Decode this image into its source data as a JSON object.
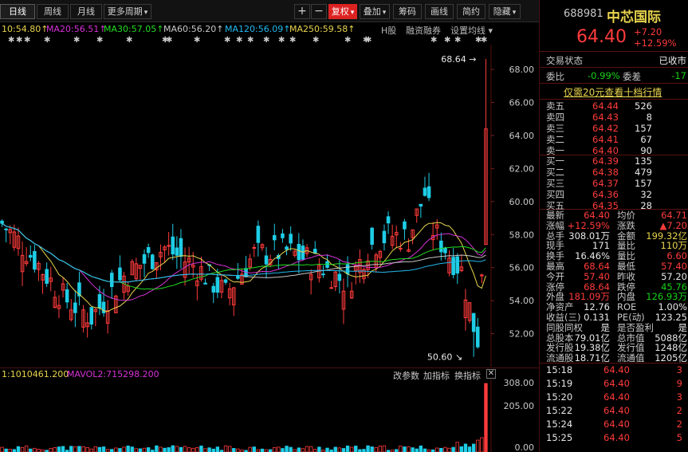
{
  "toolbar": {
    "tabs": [
      "日线",
      "周线",
      "月线",
      "更多周期"
    ],
    "buttons": [
      "+",
      "−",
      "复权",
      "叠加",
      "筹码",
      "画线",
      "简约",
      "隐藏"
    ]
  },
  "ma_line": [
    {
      "text": "10:54.80",
      "color": "#e8d44d"
    },
    {
      "text": "MA20:56.51",
      "color": "#d633d6"
    },
    {
      "text": "MA30:57.05",
      "color": "#22dd22"
    },
    {
      "text": "MA60:56.20",
      "color": "#c8c8c8"
    },
    {
      "text": "MA120:56.09",
      "color": "#22bbee"
    },
    {
      "text": "MA250:59.58",
      "color": "#e8d44d"
    }
  ],
  "ma_tools": [
    "H股",
    "融资融券",
    "设置均线"
  ],
  "price_axis": [
    "68.00",
    "66.00",
    "64.00",
    "62.00",
    "60.00",
    "58.00",
    "56.00",
    "54.00",
    "52.00"
  ],
  "annotations": {
    "high": "68.64",
    "low": "50.60"
  },
  "volume": {
    "mavol1": "1:1010461.200",
    "mavol2": "MAVOL2:715298.200",
    "tools": [
      "改参数",
      "加指标",
      "换指标"
    ],
    "axis": [
      "308.00",
      "205.00",
      "0.00"
    ]
  },
  "chart_data": {
    "type": "candlestick",
    "title": "",
    "ylim": [
      50.0,
      69.5
    ],
    "yticks": [
      52,
      54,
      56,
      58,
      60,
      62,
      64,
      66,
      68
    ],
    "high_marker": 68.64,
    "low_marker": 50.6,
    "last": 64.4
  },
  "quote": {
    "code": "688981",
    "name": "中芯国际",
    "price": "64.40",
    "change": "+7.20",
    "change_pct": "+12.59%",
    "status_label": "交易状态",
    "status_value": "已收市",
    "weibi_label": "委比",
    "weibi_value": "-0.99%",
    "weicha_label": "委差",
    "weicha_value": "-17",
    "promo": "仅需20元查看十档行情"
  },
  "sell_book": [
    {
      "label": "卖五",
      "price": "64.44",
      "vol": "526"
    },
    {
      "label": "卖四",
      "price": "64.43",
      "vol": "8"
    },
    {
      "label": "卖三",
      "price": "64.42",
      "vol": "157"
    },
    {
      "label": "卖二",
      "price": "64.41",
      "vol": "67"
    },
    {
      "label": "卖一",
      "price": "64.40",
      "vol": "90"
    }
  ],
  "buy_book": [
    {
      "label": "买一",
      "price": "64.39",
      "vol": "135"
    },
    {
      "label": "买二",
      "price": "64.38",
      "vol": "479"
    },
    {
      "label": "买三",
      "price": "64.37",
      "vol": "157"
    },
    {
      "label": "买四",
      "price": "64.36",
      "vol": "32"
    },
    {
      "label": "买五",
      "price": "64.35",
      "vol": "28"
    }
  ],
  "stats": [
    {
      "l1": "最新",
      "v1": "64.40",
      "c1": "red",
      "l2": "均价",
      "v2": "64.71",
      "c2": "red"
    },
    {
      "l1": "涨幅",
      "v1": "+12.59%",
      "c1": "red",
      "l2": "涨跌",
      "v2": "▲7.20",
      "c2": "red"
    },
    {
      "l1": "总手",
      "v1": "308.01万",
      "c1": "white",
      "l2": "金额",
      "v2": "199.32亿",
      "c2": "yellow"
    },
    {
      "l1": "现手",
      "v1": "171",
      "c1": "white",
      "l2": "量比",
      "v2": "110万",
      "c2": "yellow"
    },
    {
      "l1": "换手",
      "v1": "16.46%",
      "c1": "white",
      "l2": "量比",
      "v2": "6.60",
      "c2": "red"
    },
    {
      "l1": "最高",
      "v1": "68.64",
      "c1": "red",
      "l2": "最低",
      "v2": "57.40",
      "c2": "red"
    },
    {
      "l1": "今开",
      "v1": "57.40",
      "c1": "red",
      "l2": "昨收",
      "v2": "57.20",
      "c2": "white"
    },
    {
      "l1": "涨停",
      "v1": "68.64",
      "c1": "red",
      "l2": "跌停",
      "v2": "45.76",
      "c2": "green"
    },
    {
      "l1": "外盘",
      "v1": "181.09万",
      "c1": "red",
      "l2": "内盘",
      "v2": "126.93万",
      "c2": "green"
    },
    {
      "l1": "净资产",
      "v1": "12.76",
      "c1": "white",
      "l2": "ROE",
      "v2": "1.00%",
      "c2": "white"
    },
    {
      "l1": "收益(三)",
      "v1": "0.131",
      "c1": "white",
      "l2": "PE(动)",
      "v2": "123.25",
      "c2": "white"
    },
    {
      "l1": "同股同权",
      "v1": "是",
      "c1": "white",
      "l2": "是否盈利",
      "v2": "是",
      "c2": "white"
    },
    {
      "l1": "总股本",
      "v1": "79.01亿",
      "c1": "white",
      "l2": "总市值",
      "v2": "5088亿",
      "c2": "white"
    },
    {
      "l1": "发行股",
      "v1": "19.38亿",
      "c1": "white",
      "l2": "发行值",
      "v2": "1248亿",
      "c2": "white"
    },
    {
      "l1": "流通股",
      "v1": "18.71亿",
      "c1": "white",
      "l2": "流通值",
      "v2": "1205亿",
      "c2": "white"
    }
  ],
  "ticks": [
    {
      "time": "15:18",
      "price": "64.40",
      "vol": "3"
    },
    {
      "time": "15:19",
      "price": "64.40",
      "vol": "9"
    },
    {
      "time": "15:20",
      "price": "64.40",
      "vol": "3"
    },
    {
      "time": "15:22",
      "price": "64.40",
      "vol": "2"
    },
    {
      "time": "15:24",
      "price": "64.40",
      "vol": "2"
    },
    {
      "time": "15:25",
      "price": "64.40",
      "vol": "5"
    }
  ]
}
